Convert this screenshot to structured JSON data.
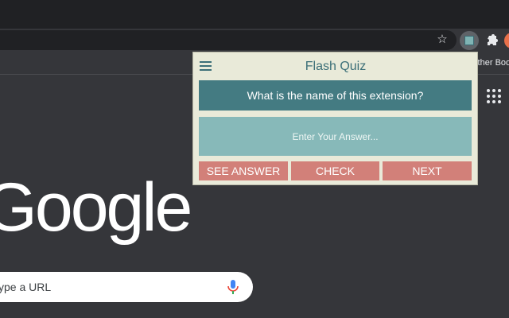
{
  "browser": {
    "bookmark_text": "Other Boo",
    "search_placeholder": "ype a URL",
    "google_logo": "Google"
  },
  "popup": {
    "title": "Flash Quiz",
    "question": "What is the name of this extension?",
    "answer_placeholder": "Enter Your Answer...",
    "buttons": {
      "see_answer": "SEE ANSWER",
      "check": "CHECK",
      "next": "NEXT"
    }
  },
  "colors": {
    "popup_bg": "#e9ead9",
    "title": "#3c6f78",
    "question_bg": "#447b82",
    "answer_bg": "#87b9b9",
    "button_bg": "#d28079"
  },
  "icons": [
    "star-icon",
    "flash-quiz-extension-icon",
    "puzzle-icon",
    "apps-grid-icon",
    "menu-icon",
    "mic-icon"
  ]
}
